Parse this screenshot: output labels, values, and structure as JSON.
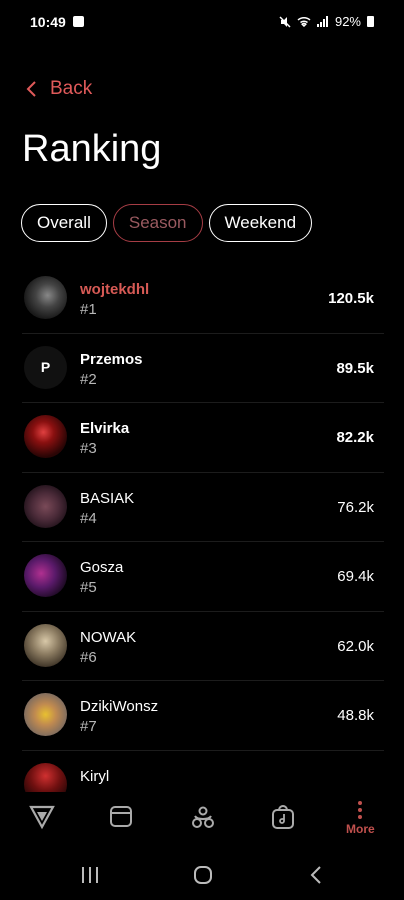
{
  "status": {
    "time": "10:49",
    "battery": "92%"
  },
  "header": {
    "back_label": "Back",
    "title": "Ranking"
  },
  "tabs": [
    {
      "label": "Overall",
      "active": false
    },
    {
      "label": "Season",
      "active": true
    },
    {
      "label": "Weekend",
      "active": false
    }
  ],
  "ranking": [
    {
      "name": "wojtekdhl",
      "rank": "#1",
      "score": "120.5k",
      "highlight": true
    },
    {
      "name": "Przemos",
      "rank": "#2",
      "score": "89.5k",
      "initial": "P"
    },
    {
      "name": "Elvirka",
      "rank": "#3",
      "score": "82.2k"
    },
    {
      "name": "BASIAK",
      "rank": "#4",
      "score": "76.2k"
    },
    {
      "name": "Gosza",
      "rank": "#5",
      "score": "69.4k"
    },
    {
      "name": "NOWAK",
      "rank": "#6",
      "score": "62.0k"
    },
    {
      "name": "DzikiWonsz",
      "rank": "#7",
      "score": "48.8k"
    },
    {
      "name": "Kiryl"
    }
  ],
  "bottom_nav": {
    "more_label": "More"
  },
  "colors": {
    "accent": "#d65a55",
    "background": "#000000"
  }
}
